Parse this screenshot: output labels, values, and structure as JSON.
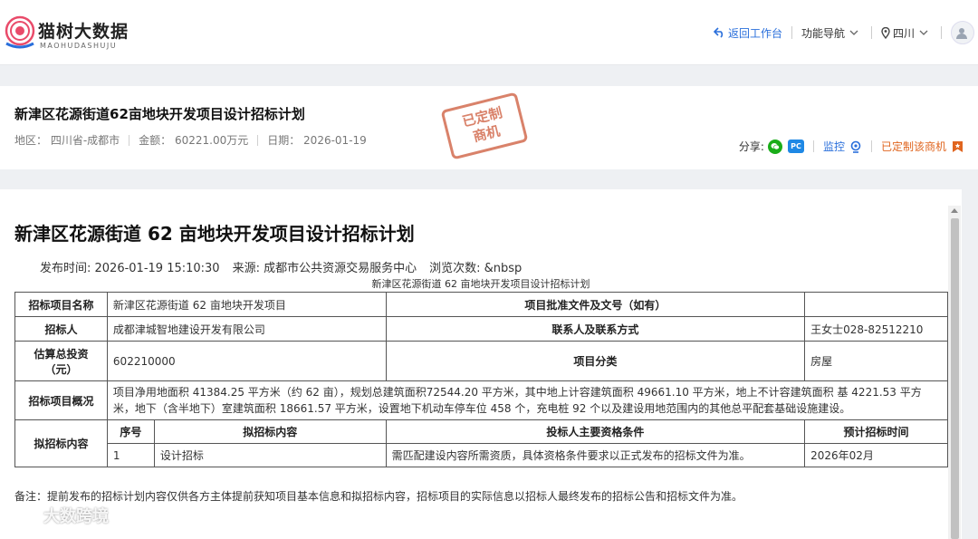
{
  "header": {
    "logo_text": "猫树大数据",
    "logo_sub": "MAOHUDASHUJU",
    "back_label": "返回工作台",
    "nav_label": "功能导航",
    "region_label": "四川"
  },
  "summary": {
    "title": "新津区花源街道62亩地块开发项目设计招标计划",
    "region": "地区： 四川省-成都市",
    "amount": "金额： 60221.00万元",
    "date": "日期： 2026-01-19",
    "stamp_line1": "已定制",
    "stamp_line2": "商机",
    "share_label": "分享:",
    "monitor_label": "监控",
    "customized_label": "已定制该商机"
  },
  "doc": {
    "title": "新津区花源街道 62 亩地块开发项目设计招标计划",
    "publish_time": "发布时间:  2026-01-19 15:10:30",
    "source": "来源:  成都市公共资源交易服务中心",
    "views": "浏览次数:   &nbsp",
    "caption": "新津区花源街道 62 亩地块开发项目设计招标计划"
  },
  "table": {
    "r1_label": "招标项目名称",
    "r1_value": "新津区花源街道 62 亩地块开发项目",
    "r1_label2": "项目批准文件及文号（如有）",
    "r1_value2": "",
    "r2_label": "招标人",
    "r2_value": "成都津城智地建设开发有限公司",
    "r2_label2": "联系人及联系方式",
    "r2_value2": "王女士028-82512210",
    "r3_label": "估算总投资（元）",
    "r3_value": "602210000",
    "r3_label2": "项目分类",
    "r3_value2": "房屋",
    "r4_label": "招标项目概况",
    "r4_value": "项目净用地面积 41384.25 平方米（约 62 亩），规划总建筑面积72544.20 平方米，其中地上计容建筑面积 49661.10 平方米，地上不计容建筑面积 基 4221.53 平方米，地下（含半地下）室建筑面积 18661.57 平方米，设置地下机动车停车位 458 个，充电桩 92 个以及建设用地范围内的其他总平配套基础设施建设。",
    "r5_label": "拟招标内容",
    "h_seq": "序号",
    "h_content": "拟招标内容",
    "h_qual": "投标人主要资格条件",
    "h_time": "预计招标时间",
    "item_seq": "1",
    "item_content": "设计招标",
    "item_qual": "需匹配建设内容所需资质，具体资格条件要求以正式发布的招标文件为准。",
    "item_time": "2026年02月"
  },
  "note": "备注：提前发布的招标计划内容仅供各方主体提前获知项目基本信息和拟招标内容，招标项目的实际信息以招标人最终发布的招标公告和招标文件为准。",
  "watermark": "大数跨境"
}
